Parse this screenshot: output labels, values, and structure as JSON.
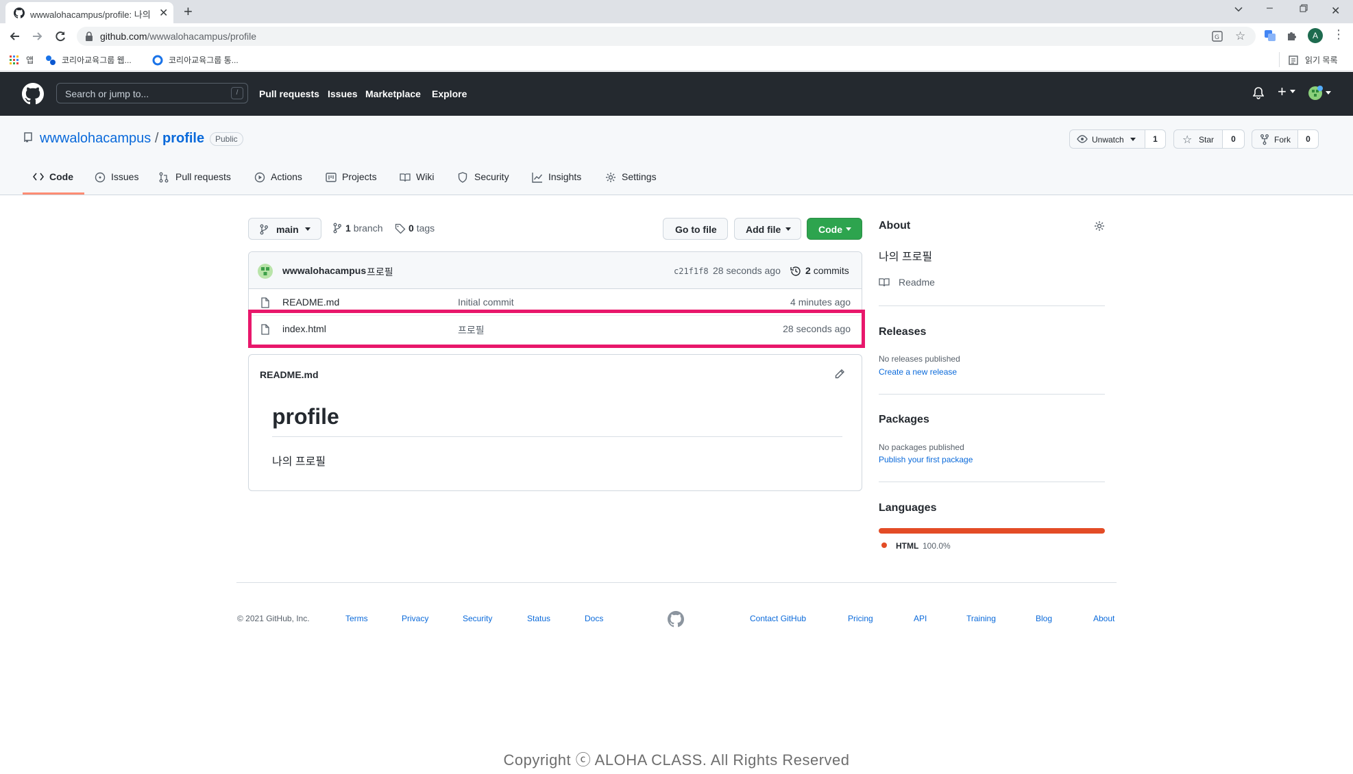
{
  "browser": {
    "tab_title": "wwwalohacampus/profile: 나의",
    "url_host": "github.com",
    "url_path": "/wwwalohacampus/profile",
    "bookmarks": {
      "apps": "앱",
      "item1": "코리아교육그룹 웹...",
      "item2": "코리아교육그룹 통...",
      "reading_list": "읽기 목록"
    },
    "profile_initial": "A"
  },
  "github_header": {
    "search_placeholder": "Search or jump to...",
    "slash_key": "/",
    "nav": [
      "Pull requests",
      "Issues",
      "Marketplace",
      "Explore"
    ]
  },
  "repo": {
    "owner": "wwwalohacampus",
    "separator": "/",
    "name": "profile",
    "visibility": "Public",
    "unwatch_label": "Unwatch",
    "unwatch_count": "1",
    "star_label": "Star",
    "star_count": "0",
    "fork_label": "Fork",
    "fork_count": "0",
    "tabs": [
      "Code",
      "Issues",
      "Pull requests",
      "Actions",
      "Projects",
      "Wiki",
      "Security",
      "Insights",
      "Settings"
    ]
  },
  "file_nav": {
    "branch": "main",
    "branch_count": "1",
    "branch_word": "branch",
    "tag_count": "0",
    "tag_word": "tags",
    "go_to_file": "Go to file",
    "add_file": "Add file",
    "code": "Code"
  },
  "commit": {
    "author": "wwwalohacampus",
    "message": "프로필",
    "sha": "c21f1f8",
    "time": "28 seconds ago",
    "commit_count": "2",
    "commit_word": "commits"
  },
  "files": [
    {
      "name": "README.md",
      "message": "Initial commit",
      "time": "4 minutes ago"
    },
    {
      "name": "index.html",
      "message": "프로필",
      "time": "28 seconds ago"
    }
  ],
  "readme": {
    "filename": "README.md",
    "heading": "profile",
    "body": "나의 프로필"
  },
  "sidebar": {
    "about_title": "About",
    "description": "나의 프로필",
    "readme_link": "Readme",
    "releases_title": "Releases",
    "releases_none": "No releases published",
    "releases_link": "Create a new release",
    "packages_title": "Packages",
    "packages_none": "No packages published",
    "packages_link": "Publish your first package",
    "languages_title": "Languages",
    "language_name": "HTML",
    "language_percent": "100.0%",
    "language_share": 100,
    "language_color": "#e34c26"
  },
  "footer": {
    "copyright": "© 2021 GitHub, Inc.",
    "left_links": [
      "Terms",
      "Privacy",
      "Security",
      "Status",
      "Docs"
    ],
    "right_links": [
      "Contact GitHub",
      "Pricing",
      "API",
      "Training",
      "Blog",
      "About"
    ]
  },
  "watermark": "Copyright ⓒ ALOHA CLASS. All Rights Reserved",
  "colors": {
    "header_bg": "#24292f",
    "link": "#0969da",
    "code_button": "#2da44e",
    "highlight": "#e8176b",
    "tab_underline": "#fd8c73"
  }
}
